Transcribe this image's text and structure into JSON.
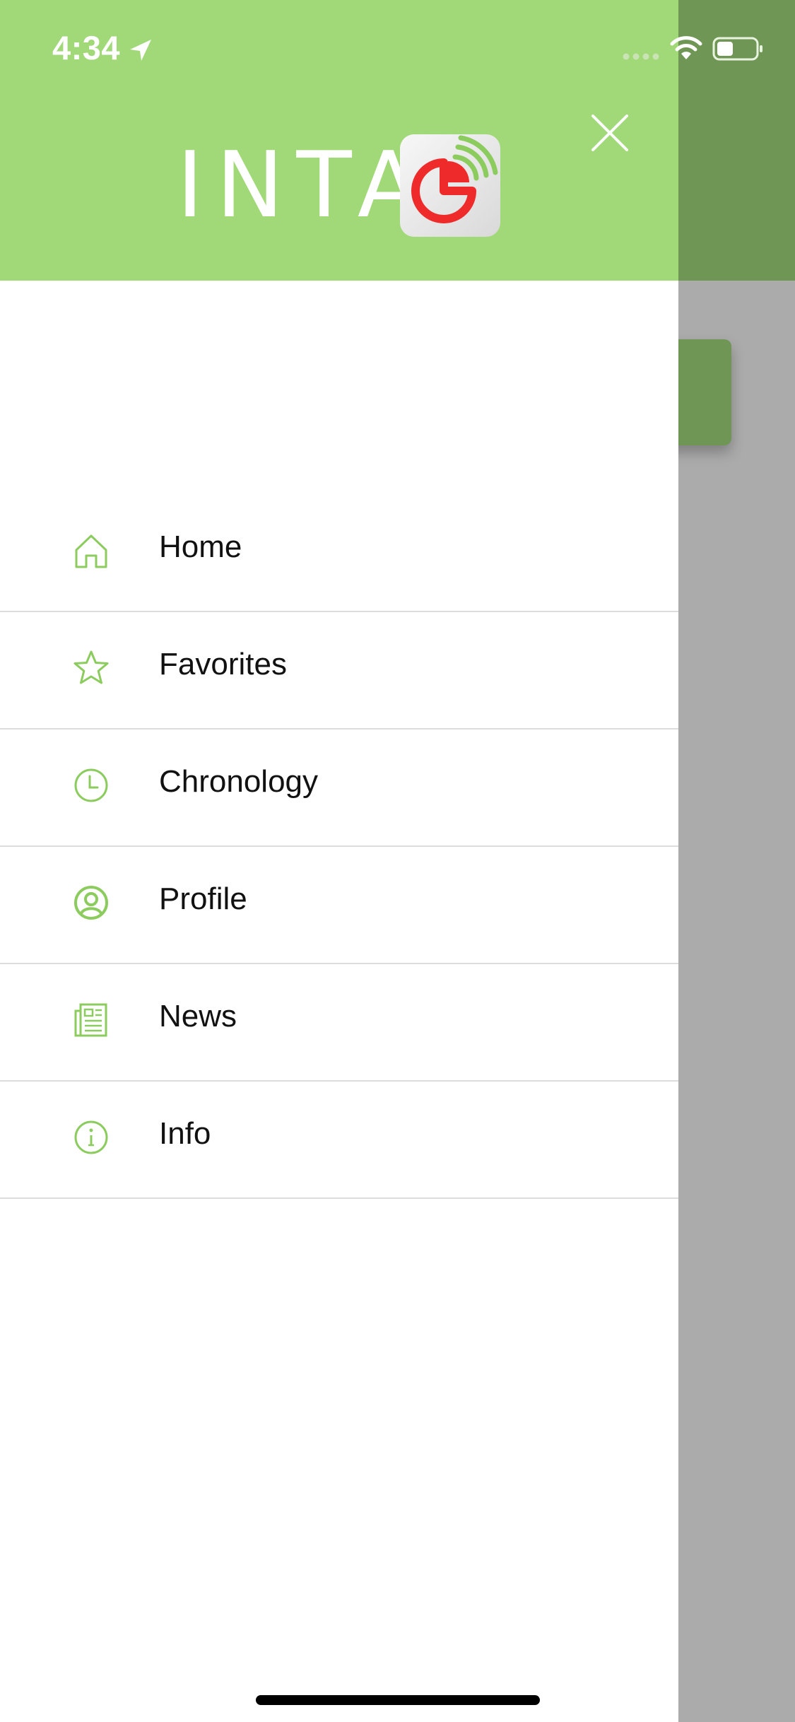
{
  "status_bar": {
    "time": "4:34",
    "location_icon": "location-arrow-icon",
    "signal_icon": "cellular-signal-icon",
    "wifi_icon": "wifi-icon",
    "battery_icon": "battery-icon"
  },
  "header": {
    "logo_text": "INTA",
    "logo_badge_icon": "pie-chart-signal-icon",
    "close_icon": "close-icon"
  },
  "menu": {
    "items": [
      {
        "label": "Home",
        "icon": "home-icon"
      },
      {
        "label": "Favorites",
        "icon": "star-icon"
      },
      {
        "label": "Chronology",
        "icon": "clock-icon"
      },
      {
        "label": "Profile",
        "icon": "user-circle-icon"
      },
      {
        "label": "News",
        "icon": "newspaper-icon"
      },
      {
        "label": "Info",
        "icon": "info-icon"
      }
    ]
  },
  "colors": {
    "accent": "#a1d878",
    "icon_green": "#8ccc5e",
    "dim_overlay": "#ababab",
    "dim_header": "#6f9655",
    "logo_red": "#ee2a2a"
  }
}
